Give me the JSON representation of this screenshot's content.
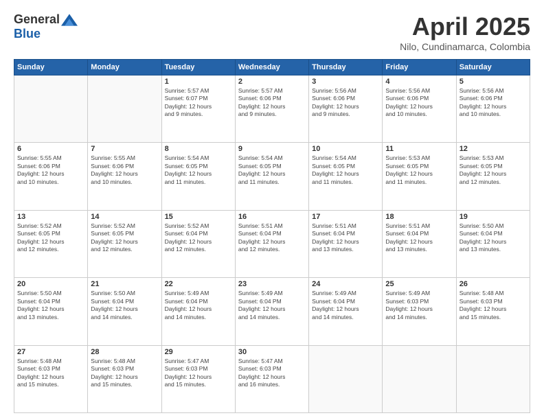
{
  "logo": {
    "general": "General",
    "blue": "Blue"
  },
  "title": "April 2025",
  "location": "Nilo, Cundinamarca, Colombia",
  "weekdays": [
    "Sunday",
    "Monday",
    "Tuesday",
    "Wednesday",
    "Thursday",
    "Friday",
    "Saturday"
  ],
  "weeks": [
    [
      {
        "day": "",
        "info": ""
      },
      {
        "day": "",
        "info": ""
      },
      {
        "day": "1",
        "info": "Sunrise: 5:57 AM\nSunset: 6:07 PM\nDaylight: 12 hours\nand 9 minutes."
      },
      {
        "day": "2",
        "info": "Sunrise: 5:57 AM\nSunset: 6:06 PM\nDaylight: 12 hours\nand 9 minutes."
      },
      {
        "day": "3",
        "info": "Sunrise: 5:56 AM\nSunset: 6:06 PM\nDaylight: 12 hours\nand 9 minutes."
      },
      {
        "day": "4",
        "info": "Sunrise: 5:56 AM\nSunset: 6:06 PM\nDaylight: 12 hours\nand 10 minutes."
      },
      {
        "day": "5",
        "info": "Sunrise: 5:56 AM\nSunset: 6:06 PM\nDaylight: 12 hours\nand 10 minutes."
      }
    ],
    [
      {
        "day": "6",
        "info": "Sunrise: 5:55 AM\nSunset: 6:06 PM\nDaylight: 12 hours\nand 10 minutes."
      },
      {
        "day": "7",
        "info": "Sunrise: 5:55 AM\nSunset: 6:06 PM\nDaylight: 12 hours\nand 10 minutes."
      },
      {
        "day": "8",
        "info": "Sunrise: 5:54 AM\nSunset: 6:05 PM\nDaylight: 12 hours\nand 11 minutes."
      },
      {
        "day": "9",
        "info": "Sunrise: 5:54 AM\nSunset: 6:05 PM\nDaylight: 12 hours\nand 11 minutes."
      },
      {
        "day": "10",
        "info": "Sunrise: 5:54 AM\nSunset: 6:05 PM\nDaylight: 12 hours\nand 11 minutes."
      },
      {
        "day": "11",
        "info": "Sunrise: 5:53 AM\nSunset: 6:05 PM\nDaylight: 12 hours\nand 11 minutes."
      },
      {
        "day": "12",
        "info": "Sunrise: 5:53 AM\nSunset: 6:05 PM\nDaylight: 12 hours\nand 12 minutes."
      }
    ],
    [
      {
        "day": "13",
        "info": "Sunrise: 5:52 AM\nSunset: 6:05 PM\nDaylight: 12 hours\nand 12 minutes."
      },
      {
        "day": "14",
        "info": "Sunrise: 5:52 AM\nSunset: 6:05 PM\nDaylight: 12 hours\nand 12 minutes."
      },
      {
        "day": "15",
        "info": "Sunrise: 5:52 AM\nSunset: 6:04 PM\nDaylight: 12 hours\nand 12 minutes."
      },
      {
        "day": "16",
        "info": "Sunrise: 5:51 AM\nSunset: 6:04 PM\nDaylight: 12 hours\nand 12 minutes."
      },
      {
        "day": "17",
        "info": "Sunrise: 5:51 AM\nSunset: 6:04 PM\nDaylight: 12 hours\nand 13 minutes."
      },
      {
        "day": "18",
        "info": "Sunrise: 5:51 AM\nSunset: 6:04 PM\nDaylight: 12 hours\nand 13 minutes."
      },
      {
        "day": "19",
        "info": "Sunrise: 5:50 AM\nSunset: 6:04 PM\nDaylight: 12 hours\nand 13 minutes."
      }
    ],
    [
      {
        "day": "20",
        "info": "Sunrise: 5:50 AM\nSunset: 6:04 PM\nDaylight: 12 hours\nand 13 minutes."
      },
      {
        "day": "21",
        "info": "Sunrise: 5:50 AM\nSunset: 6:04 PM\nDaylight: 12 hours\nand 14 minutes."
      },
      {
        "day": "22",
        "info": "Sunrise: 5:49 AM\nSunset: 6:04 PM\nDaylight: 12 hours\nand 14 minutes."
      },
      {
        "day": "23",
        "info": "Sunrise: 5:49 AM\nSunset: 6:04 PM\nDaylight: 12 hours\nand 14 minutes."
      },
      {
        "day": "24",
        "info": "Sunrise: 5:49 AM\nSunset: 6:04 PM\nDaylight: 12 hours\nand 14 minutes."
      },
      {
        "day": "25",
        "info": "Sunrise: 5:49 AM\nSunset: 6:03 PM\nDaylight: 12 hours\nand 14 minutes."
      },
      {
        "day": "26",
        "info": "Sunrise: 5:48 AM\nSunset: 6:03 PM\nDaylight: 12 hours\nand 15 minutes."
      }
    ],
    [
      {
        "day": "27",
        "info": "Sunrise: 5:48 AM\nSunset: 6:03 PM\nDaylight: 12 hours\nand 15 minutes."
      },
      {
        "day": "28",
        "info": "Sunrise: 5:48 AM\nSunset: 6:03 PM\nDaylight: 12 hours\nand 15 minutes."
      },
      {
        "day": "29",
        "info": "Sunrise: 5:47 AM\nSunset: 6:03 PM\nDaylight: 12 hours\nand 15 minutes."
      },
      {
        "day": "30",
        "info": "Sunrise: 5:47 AM\nSunset: 6:03 PM\nDaylight: 12 hours\nand 16 minutes."
      },
      {
        "day": "",
        "info": ""
      },
      {
        "day": "",
        "info": ""
      },
      {
        "day": "",
        "info": ""
      }
    ]
  ]
}
